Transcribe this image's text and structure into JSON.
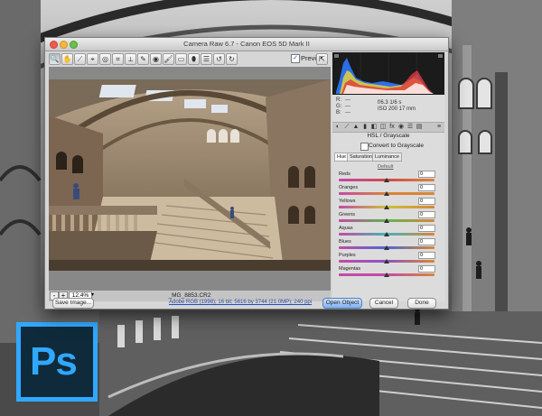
{
  "window": {
    "title": "Camera Raw 6.7 - Canon EOS 5D Mark II"
  },
  "toolbar": {
    "tools": [
      {
        "icon": "zoom-icon",
        "glyph": "🔍"
      },
      {
        "icon": "hand-icon",
        "glyph": "✋"
      },
      {
        "icon": "white-balance-icon",
        "glyph": "⟋"
      },
      {
        "icon": "color-sampler-icon",
        "glyph": "⌖"
      },
      {
        "icon": "target-adjust-icon",
        "glyph": "◎"
      },
      {
        "icon": "crop-icon",
        "glyph": "⌗"
      },
      {
        "icon": "straighten-icon",
        "glyph": "⟂"
      },
      {
        "icon": "spot-removal-icon",
        "glyph": "✎"
      },
      {
        "icon": "red-eye-icon",
        "glyph": "◉"
      },
      {
        "icon": "adjustment-brush-icon",
        "glyph": "🖌"
      },
      {
        "icon": "graduated-filter-icon",
        "glyph": "▭"
      },
      {
        "icon": "radial-filter-icon",
        "glyph": "⬮"
      },
      {
        "icon": "preferences-icon",
        "glyph": "☰"
      },
      {
        "icon": "rotate-left-icon",
        "glyph": "↺"
      },
      {
        "icon": "rotate-right-icon",
        "glyph": "↻"
      }
    ],
    "preview_label": "Preview",
    "preview_checked": "✓"
  },
  "bottombar": {
    "zoom_minus": "-",
    "zoom_plus": "+",
    "zoom_value": "12.4%",
    "filename": "_MG_8853.CR2"
  },
  "readout": {
    "r_label": "R:",
    "r_value": "---",
    "g_label": "G:",
    "g_value": "---",
    "b_label": "B:",
    "b_value": "---",
    "aperture_shutter": "f/6.3   1/6 s",
    "iso_focal": "ISO 200   17 mm"
  },
  "panel": {
    "title": "HSL / Grayscale",
    "convert_label": "Convert to Grayscale",
    "tabs": [
      "Hue",
      "Saturation",
      "Luminance"
    ],
    "default_link": "Default",
    "sliders": [
      {
        "label": "Reds",
        "value": "0",
        "color": "#d14a4a"
      },
      {
        "label": "Oranges",
        "value": "0",
        "color": "#d9853a"
      },
      {
        "label": "Yellows",
        "value": "0",
        "color": "#c9c234"
      },
      {
        "label": "Greens",
        "value": "0",
        "color": "#5fb44f"
      },
      {
        "label": "Aquas",
        "value": "0",
        "color": "#48b3b5"
      },
      {
        "label": "Blues",
        "value": "0",
        "color": "#4a6bd0"
      },
      {
        "label": "Purples",
        "value": "0",
        "color": "#8b54c4"
      },
      {
        "label": "Magentas",
        "value": "0",
        "color": "#c44aa6"
      }
    ]
  },
  "buttons": {
    "save": "Save Image...",
    "info": "Adobe RGB (1998); 16 bit; 5616 by 3744 (21.0MP); 240 ppi",
    "open": "Open Object",
    "cancel": "Cancel",
    "done": "Done"
  },
  "logo": {
    "text": "Ps"
  }
}
